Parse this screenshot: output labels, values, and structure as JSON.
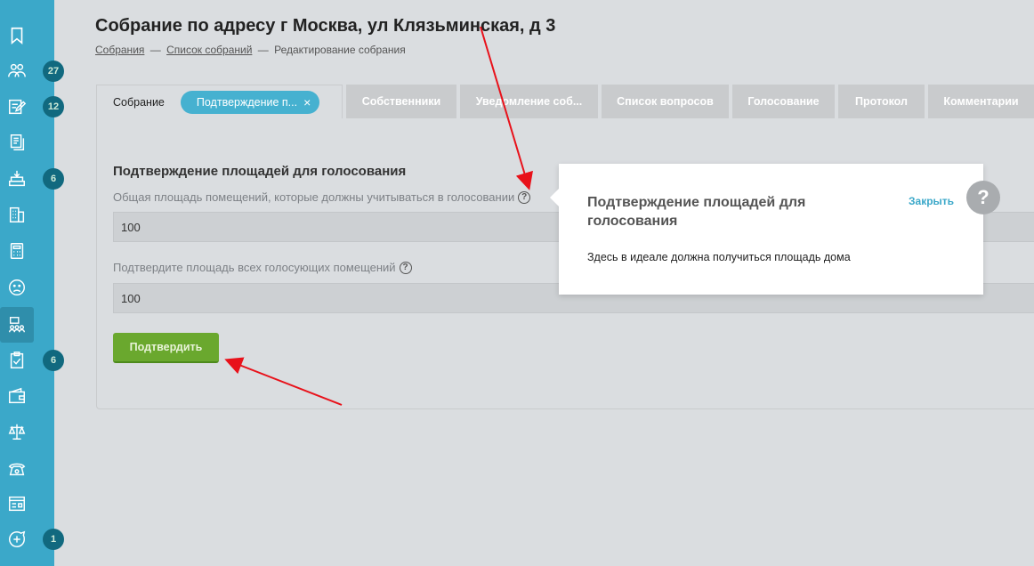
{
  "sidebar": {
    "items": [
      {
        "icon": "flag-icon",
        "badge": ""
      },
      {
        "icon": "people-icon",
        "badge": "27"
      },
      {
        "icon": "edit-icon",
        "badge": "12"
      },
      {
        "icon": "documents-icon",
        "badge": ""
      },
      {
        "icon": "inbox-tray-icon",
        "badge": "6"
      },
      {
        "icon": "building-icon",
        "badge": ""
      },
      {
        "icon": "calculator-icon",
        "badge": ""
      },
      {
        "icon": "sad-face-icon",
        "badge": ""
      },
      {
        "icon": "meeting-icon",
        "badge": "",
        "active": true
      },
      {
        "icon": "checklist-icon",
        "badge": "6"
      },
      {
        "icon": "wallet-icon",
        "badge": ""
      },
      {
        "icon": "scales-icon",
        "badge": ""
      },
      {
        "icon": "phone-icon",
        "badge": ""
      },
      {
        "icon": "browser-window-icon",
        "badge": ""
      },
      {
        "icon": "chat-add-icon",
        "badge": "1"
      }
    ]
  },
  "header": {
    "title": "Собрание по адресу г Москва, ул Клязьминская, д 3",
    "breadcrumb": {
      "link1": "Собрания",
      "link2": "Список собраний",
      "current": "Редактирование собрания",
      "separator": "—"
    }
  },
  "tabs": {
    "active": "Собрание",
    "pill": "Подтверждение п...",
    "pill_close": "×",
    "others": [
      "Собственники",
      "Уведомление соб...",
      "Список вопросов",
      "Голосование",
      "Протокол",
      "Комментарии"
    ]
  },
  "form": {
    "section_title": "Подтверждение площадей для голосования",
    "field1_label": "Общая площадь помещений, которые должны учитываться в голосовании",
    "field1_value": "100",
    "field2_label": "Подтвердите площадь всех голосующих помещений",
    "field2_value": "100",
    "confirm_label": "Подтвердить",
    "help_glyph": "?"
  },
  "popup": {
    "title": "Подтверждение площадей для голосования",
    "close_label": "Закрыть",
    "body": "Здесь в идеале должна получиться площадь дома",
    "help_glyph": "?"
  },
  "colors": {
    "sidebar": "#3ba8c9",
    "badge": "#11697f",
    "confirm": "#6aa82e",
    "annotation": "#e8111a"
  }
}
